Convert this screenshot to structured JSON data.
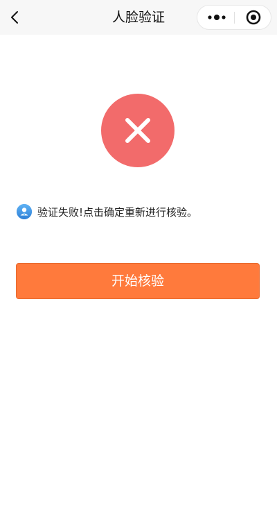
{
  "header": {
    "title": "人脸验证",
    "back_icon": "chevron-left-icon",
    "menu_icon": "more-dots-icon",
    "close_icon": "target-circle-icon"
  },
  "status": {
    "icon": "close-x-icon",
    "color": "#f26b6b"
  },
  "message": {
    "icon": "user-badge-icon",
    "text": "验证失败!点击确定重新进行核验。"
  },
  "actions": {
    "start_label": "开始核验",
    "start_color": "#ff7a3c"
  }
}
